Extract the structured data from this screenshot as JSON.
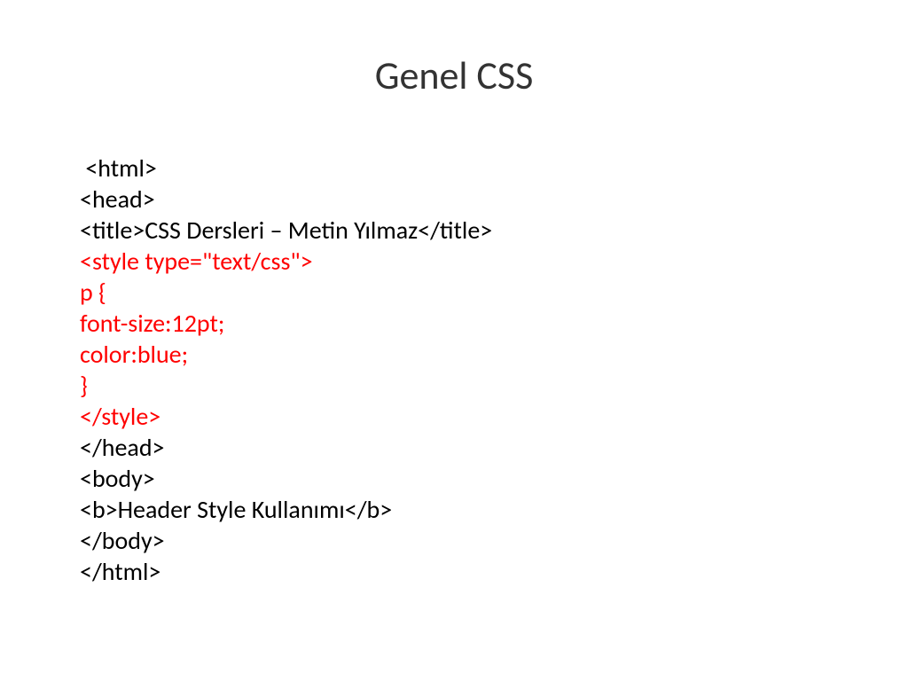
{
  "title": "Genel CSS",
  "code": {
    "line1": " <html>",
    "line2": "<head>",
    "line3": "<title>CSS Dersleri – Metin Yılmaz</title>",
    "line4": "<style type=\"text/css\">",
    "line5": "p {",
    "line6": "font-size:12pt;",
    "line7": "color:blue;",
    "line8": "}",
    "line9": "</style>",
    "line10": "</head>",
    "line11": "<body>",
    "line12": "<b>Header Style Kullanımı</b>",
    "line13": "</body>",
    "line14": "</html>"
  }
}
